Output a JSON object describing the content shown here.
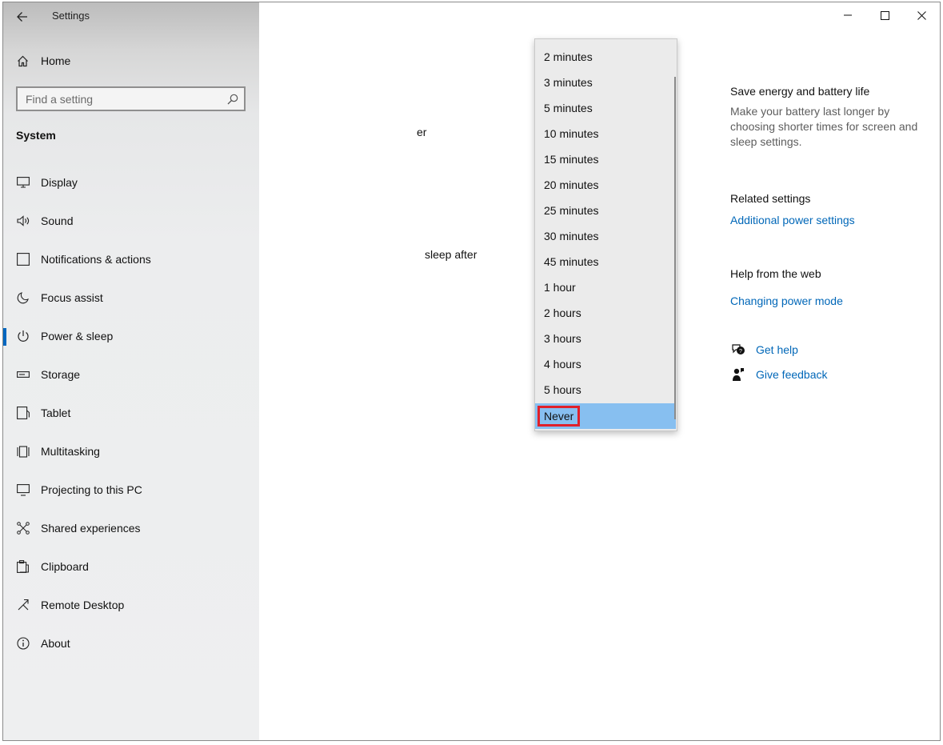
{
  "window": {
    "title": "Settings"
  },
  "sidebar": {
    "home_label": "Home",
    "search_placeholder": "Find a setting",
    "section_title": "System",
    "items": [
      {
        "label": "Display",
        "icon": "display-icon"
      },
      {
        "label": "Sound",
        "icon": "sound-icon"
      },
      {
        "label": "Notifications & actions",
        "icon": "notifications-icon"
      },
      {
        "label": "Focus assist",
        "icon": "moon-icon"
      },
      {
        "label": "Power & sleep",
        "icon": "power-icon",
        "active": true
      },
      {
        "label": "Storage",
        "icon": "storage-icon"
      },
      {
        "label": "Tablet",
        "icon": "tablet-icon"
      },
      {
        "label": "Multitasking",
        "icon": "multitasking-icon"
      },
      {
        "label": "Projecting to this PC",
        "icon": "projecting-icon"
      },
      {
        "label": "Shared experiences",
        "icon": "shared-icon"
      },
      {
        "label": "Clipboard",
        "icon": "clipboard-icon"
      },
      {
        "label": "Remote Desktop",
        "icon": "remote-desktop-icon"
      },
      {
        "label": "About",
        "icon": "info-icon"
      }
    ]
  },
  "dropdown": {
    "options": [
      "2 minutes",
      "3 minutes",
      "5 minutes",
      "10 minutes",
      "15 minutes",
      "20 minutes",
      "25 minutes",
      "30 minutes",
      "45 minutes",
      "1 hour",
      "2 hours",
      "3 hours",
      "4 hours",
      "5 hours",
      "Never"
    ],
    "selected": "Never",
    "highlight_color": "#87bff0",
    "annotation_color": "#e0202a"
  },
  "main": {
    "partial_texts": [
      "er",
      "sleep after"
    ]
  },
  "right_panel": {
    "save_energy_heading": "Save energy and battery life",
    "save_energy_desc": "Make your battery last longer by choosing shorter times for screen and sleep settings.",
    "related_heading": "Related settings",
    "related_link": "Additional power settings",
    "help_heading": "Help from the web",
    "help_link": "Changing power mode",
    "get_help": "Get help",
    "give_feedback": "Give feedback"
  },
  "colors": {
    "accent": "#0067b8",
    "active_indicator": "#0067c0"
  }
}
